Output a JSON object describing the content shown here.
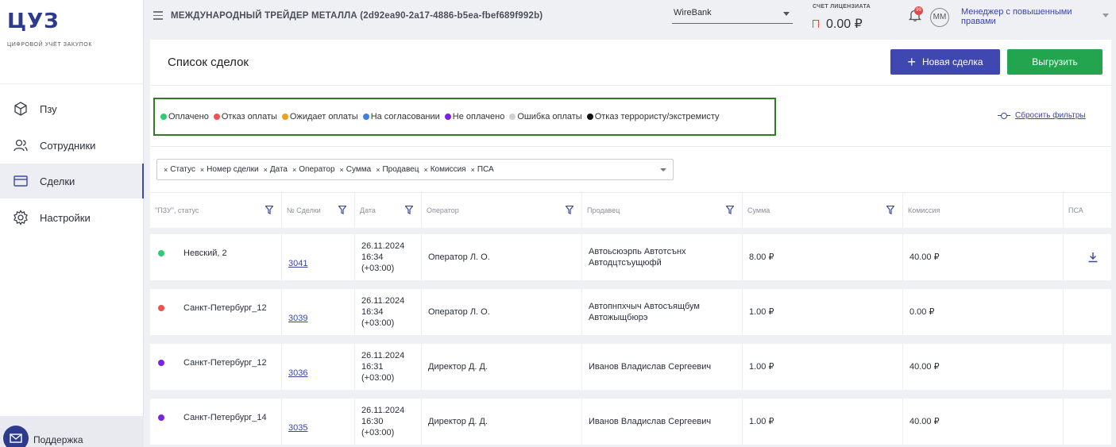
{
  "sidebar": {
    "logo": "ЦУЗ",
    "logo_subtitle": "цифровой учёт закупок",
    "items": [
      {
        "label": "Пзу",
        "icon": "cube-icon"
      },
      {
        "label": "Сотрудники",
        "icon": "users-icon"
      },
      {
        "label": "Сделки",
        "icon": "card-icon",
        "active": true
      },
      {
        "label": "Настройки",
        "icon": "gear-icon"
      }
    ],
    "support_label": "Поддержка"
  },
  "topbar": {
    "company": "МЕЖДУНАРОДНЫЙ ТРЕЙДЕР МЕТАЛЛА (2d92ea90-2a17-4886-b5ea-fbef689f992b)",
    "bank_selected": "WireBank",
    "account_label": "СЧЕТ ЛИЦЕНЗИАТА",
    "account_value": "0.00 ₽",
    "notification_badge": "99",
    "avatar_initials": "ММ",
    "role": "Менеджер с повышенными правами"
  },
  "page": {
    "title": "Список сделок",
    "new_deal_label": "Новая сделка",
    "export_label": "Выгрузить",
    "reset_filters_label": "Сбросить фильтры"
  },
  "legend": [
    {
      "label": "Оплачено",
      "color": "#2ecc71"
    },
    {
      "label": "Отказ оплаты",
      "color": "#ef5350"
    },
    {
      "label": "Ожидает оплаты",
      "color": "#f0a020"
    },
    {
      "label": "На согласовании",
      "color": "#3f7fe0"
    },
    {
      "label": "Не оплачено",
      "color": "#7a22e6"
    },
    {
      "label": "Ошибка оплаты",
      "color": "#d0d0d0"
    },
    {
      "label": "Отказ террористу/экстремисту",
      "color": "#111111"
    }
  ],
  "column_chips": [
    "Статус",
    "Номер сделки",
    "Дата",
    "Оператор",
    "Сумма",
    "Продавец",
    "Комиссия",
    "ПСА"
  ],
  "columns": [
    "\"ПЗУ\", статус",
    "№ Сделки",
    "Дата",
    "Оператор",
    "Продавец",
    "Сумма",
    "Комиссия",
    "ПСА"
  ],
  "rows": [
    {
      "status_color": "#2ecc71",
      "pzu": "Невский, 2",
      "deal": "3041",
      "date": "26.11.2024",
      "time": "16:34",
      "tz": "(+03:00)",
      "operator": "Оператор Л. О.",
      "seller": "Автоьсюэрпь Автотсънх Автодцтсъущюфй",
      "sum": "8.00 ₽",
      "commission": "40.00 ₽",
      "psa_download": true
    },
    {
      "status_color": "#ef5350",
      "pzu": "Санкт-Петербург_12",
      "deal": "3039",
      "date": "26.11.2024",
      "time": "16:34",
      "tz": "(+03:00)",
      "operator": "Оператор Л. О.",
      "seller": "Автопнпхчыч Автосъящбум Автожыщбюрэ",
      "sum": "1.00 ₽",
      "commission": "0.00 ₽",
      "psa_download": false
    },
    {
      "status_color": "#7a22e6",
      "pzu": "Санкт-Петербург_12",
      "deal": "3036",
      "date": "26.11.2024",
      "time": "16:31",
      "tz": "(+03:00)",
      "operator": "Директор Д. Д.",
      "seller": "Иванов Владислав Сергеевич",
      "sum": "1.00 ₽",
      "commission": "40.00 ₽",
      "psa_download": false
    },
    {
      "status_color": "#7a22e6",
      "pzu": "Санкт-Петербург_14",
      "deal": "3035",
      "date": "26.11.2024",
      "time": "16:30",
      "tz": "(+03:00)",
      "operator": "Директор Д. Д.",
      "seller": "Иванов Владислав Сергеевич",
      "sum": "1.00 ₽",
      "commission": "40.00 ₽",
      "psa_download": false
    }
  ]
}
